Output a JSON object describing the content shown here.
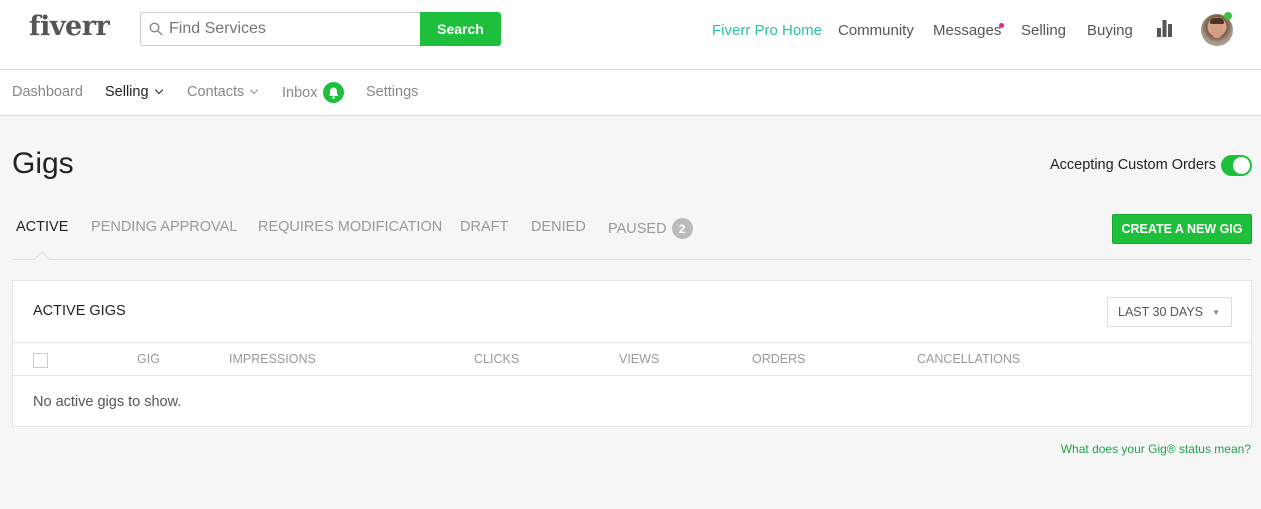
{
  "header": {
    "logo": "fiverr",
    "search": {
      "placeholder": "Find Services",
      "value": "",
      "button": "Search"
    },
    "nav": [
      {
        "label": "Fiverr Pro Home",
        "highlight": true
      },
      {
        "label": "Community"
      },
      {
        "label": "Messages",
        "has_notification": true
      },
      {
        "label": "Selling"
      },
      {
        "label": "Buying"
      }
    ],
    "icons": [
      "stats-icon",
      "avatar"
    ],
    "online": true
  },
  "subnav": {
    "items": [
      {
        "label": "Dashboard"
      },
      {
        "label": "Selling",
        "active": true,
        "dropdown": true
      },
      {
        "label": "Contacts",
        "dropdown": true
      },
      {
        "label": "Inbox",
        "icon": "bell-icon"
      },
      {
        "label": "Settings"
      }
    ]
  },
  "page": {
    "title": "Gigs",
    "custom_orders": {
      "label": "Accepting Custom Orders",
      "enabled": true
    },
    "tabs": [
      {
        "label": "ACTIVE",
        "active": true
      },
      {
        "label": "PENDING APPROVAL"
      },
      {
        "label": "REQUIRES MODIFICATION"
      },
      {
        "label": "DRAFT"
      },
      {
        "label": "DENIED"
      },
      {
        "label": "PAUSED",
        "count": "2"
      }
    ],
    "create_button": "CREATE A NEW GIG"
  },
  "card": {
    "title": "ACTIVE GIGS",
    "period": "LAST 30 DAYS",
    "columns": [
      "GIG",
      "IMPRESSIONS",
      "CLICKS",
      "VIEWS",
      "ORDERS",
      "CANCELLATIONS"
    ],
    "empty_message": "No active gigs to show."
  },
  "help_link": "What does your Gig® status mean?",
  "colors": {
    "brand_green": "#1dbf3b",
    "pro_teal": "#2bc1a5",
    "notification_pink": "#e0298a"
  }
}
